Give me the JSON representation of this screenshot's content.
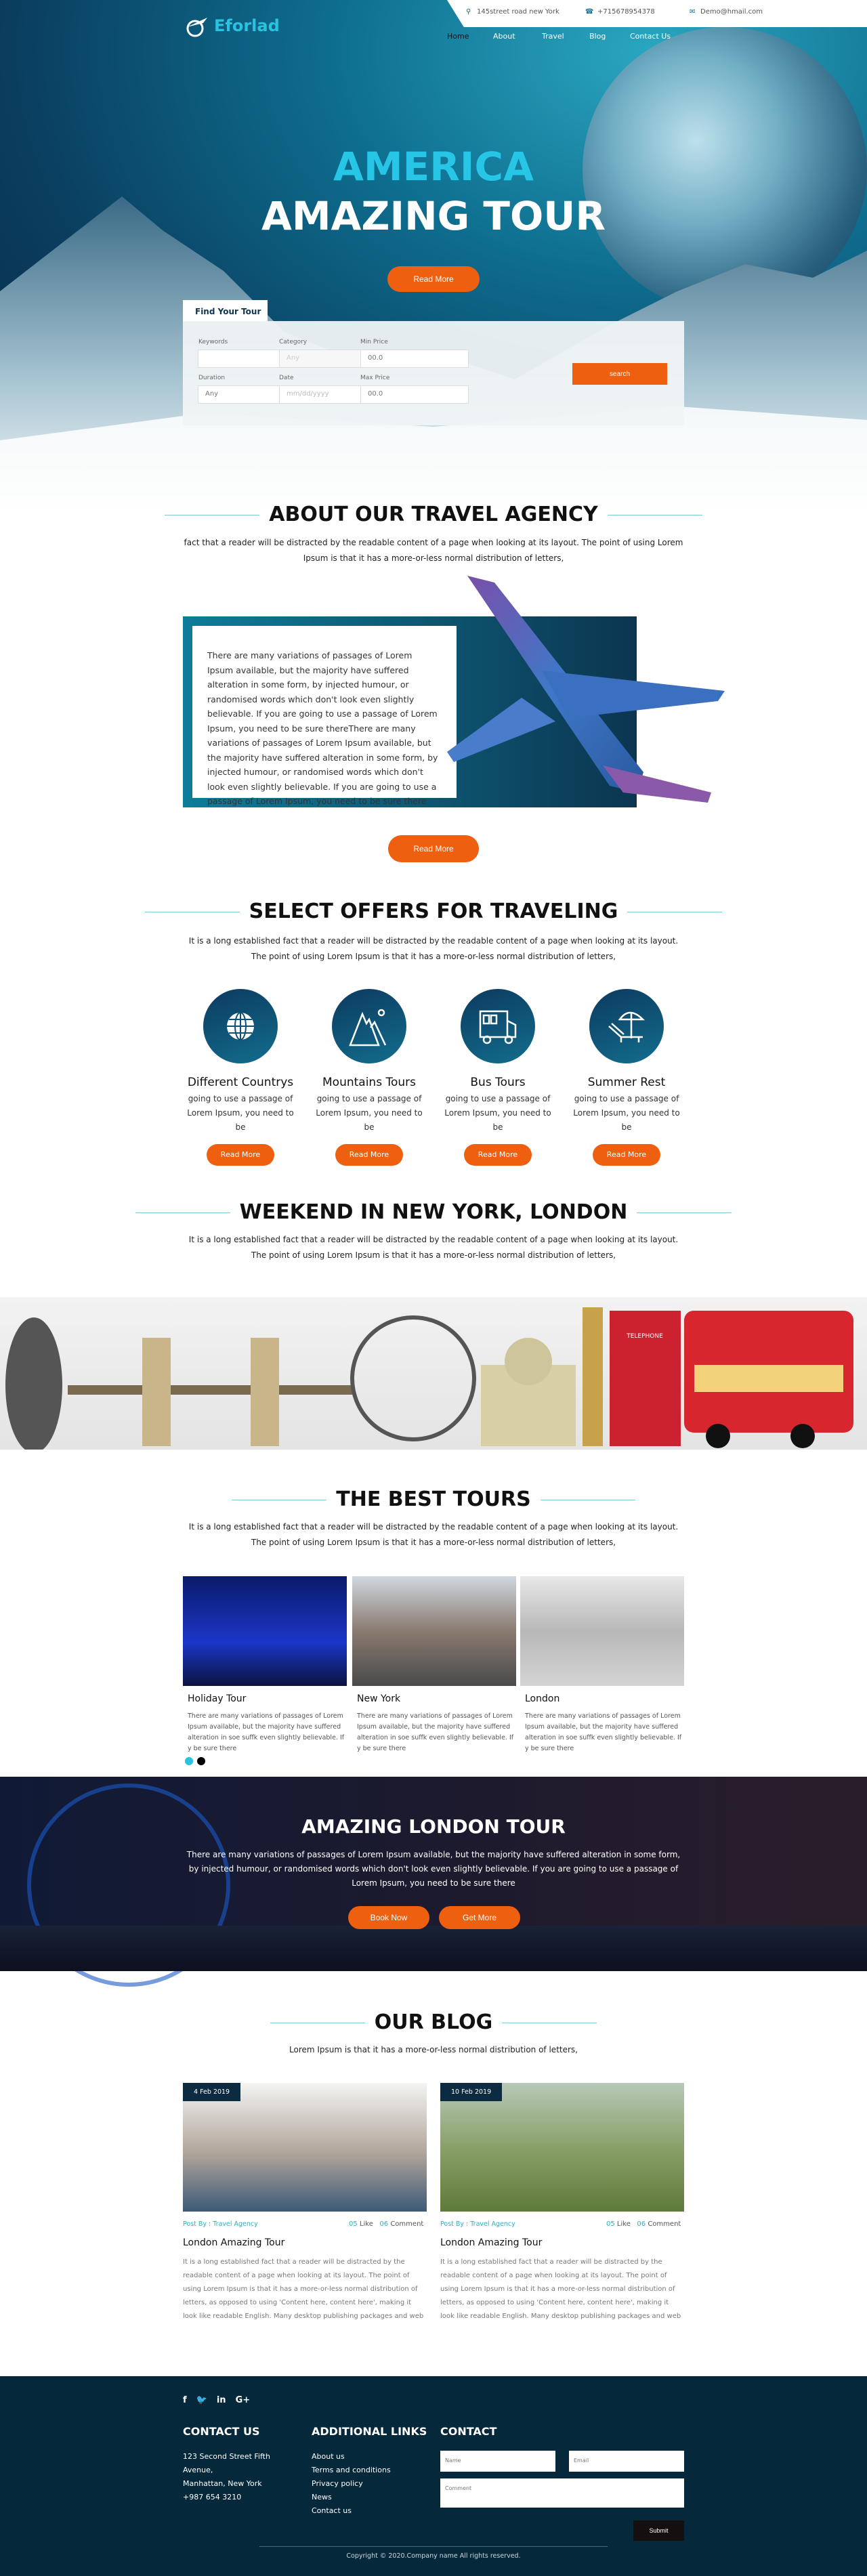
{
  "header": {
    "brand": "Eforlad",
    "address": "145street road new York",
    "phone": "+715678954378",
    "email": "Demo@hmail.com",
    "nav": [
      {
        "label": "Home",
        "active": true
      },
      {
        "label": "About"
      },
      {
        "label": "Travel"
      },
      {
        "label": "Blog"
      },
      {
        "label": "Contact Us"
      }
    ]
  },
  "hero": {
    "title_line1": "AMERICA",
    "title_line2": "AMAZING TOUR",
    "button": "Read More"
  },
  "search": {
    "tab": "Find Your Tour",
    "keywords_label": "Keywords",
    "keywords_value": "",
    "category_label": "Category",
    "category_value": "Any",
    "min_price_label": "Min Price",
    "min_price_value": "00.0",
    "duration_label": "Duration",
    "duration_value": "Any",
    "date_label": "Date",
    "date_placeholder": "mm/dd/yyyy",
    "max_price_label": "Max Price",
    "max_price_value": "00.0",
    "button": "search"
  },
  "about": {
    "title": "ABOUT OUR TRAVEL AGENCY",
    "intro": "fact that a reader will be distracted by the readable content of a page when looking at its layout. The point of using Lorem Ipsum is that it has a more-or-less normal distribution of letters,",
    "body": "There are many variations of passages of Lorem Ipsum available, but the majority have suffered alteration in some form, by injected humour, or randomised words which don't look even slightly believable. If you are going to use a passage of Lorem Ipsum, you need to be sure thereThere are many variations of passages of Lorem Ipsum available, but the majority have suffered alteration in some form, by injected humour, or randomised words which don't look even slightly believable. If you are going to use a passage of Lorem Ipsum, you need to be sure there",
    "button": "Read More"
  },
  "offers": {
    "title": "SELECT OFFERS FOR TRAVELING",
    "intro": "It is a long established fact that a reader will be distracted by the readable content of a page when looking at its layout. The point of using Lorem Ipsum is that it has a more-or-less normal distribution of letters,",
    "items": [
      {
        "title": "Different Countrys",
        "text": "going to use a passage of Lorem Ipsum, you need to be",
        "button": "Read More",
        "icon": "globe-icon"
      },
      {
        "title": "Mountains Tours",
        "text": "going to use a passage of Lorem Ipsum, you need to be",
        "button": "Read More",
        "icon": "mountain-icon"
      },
      {
        "title": "Bus Tours",
        "text": "going to use a passage of Lorem Ipsum, you need to be",
        "button": "Read More",
        "icon": "bus-icon"
      },
      {
        "title": "Summer Rest",
        "text": "going to use a passage of Lorem Ipsum, you need to be",
        "button": "Read More",
        "icon": "beach-umbrella-icon"
      }
    ]
  },
  "weekend": {
    "title": "WEEKEND IN NEW YORK, LONDON",
    "intro": "It is a long established fact that a reader will be distracted by the readable content of a page when looking at its layout. The point of using Lorem Ipsum is that it has a more-or-less normal distribution of letters,",
    "phone_box_label": "TELEPHONE"
  },
  "tours": {
    "title": "THE BEST TOURS",
    "intro": "It is a long established fact that a reader will be distracted by the readable content of a page when looking at its layout. The point of using Lorem Ipsum is that it has a more-or-less normal distribution of letters,",
    "items": [
      {
        "title": "Holiday Tour",
        "text": "There are many variations of passages of Lorem Ipsum available, but the majority have suffered alteration in soe suffk even slightly believable. If y be sure there"
      },
      {
        "title": "New York",
        "text": "There are many variations of passages of Lorem Ipsum available, but the majority have suffered alteration in soe suffk even slightly believable. If y be sure there"
      },
      {
        "title": "London",
        "text": "There are many variations of passages of Lorem Ipsum available, but the majority have suffered alteration in soe suffk even slightly believable. If y be sure there"
      }
    ],
    "active_dot": 0
  },
  "london": {
    "title": "AMAZING LONDON TOUR",
    "text": "There are many variations of passages of Lorem Ipsum available, but the majority have suffered alteration in some form, by injected humour, or randomised words which don't look even slightly believable. If you are going to use a passage of Lorem Ipsum, you need to be sure there",
    "book": "Book Now",
    "more": "Get More"
  },
  "blog": {
    "title": "OUR BLOG",
    "intro": "Lorem Ipsum is that it has a more-or-less normal distribution of letters,",
    "posts": [
      {
        "date": "4 Feb 2019",
        "by": "Post By : Travel Agency",
        "likes": "05",
        "like_label": "Like",
        "comments": "06",
        "comment_label": "Comment",
        "title": "London Amazing Tour",
        "text": "It is a long established fact that a reader will be distracted by the readable content of a page when looking at its layout. The point of using Lorem Ipsum is that it has a more-or-less normal distribution of letters, as opposed to using 'Content here, content here', making it look like readable English. Many desktop publishing packages and web"
      },
      {
        "date": "10 Feb 2019",
        "by": "Post By : Travel Agency",
        "likes": "05",
        "like_label": "Like",
        "comments": "06",
        "comment_label": "Comment",
        "title": "London Amazing Tour",
        "text": "It is a long established fact that a reader will be distracted by the readable content of a page when looking at its layout. The point of using Lorem Ipsum is that it has a more-or-less normal distribution of letters, as opposed to using 'Content here, content here', making it look like readable English. Many desktop publishing packages and web"
      }
    ]
  },
  "footer": {
    "social": [
      "f",
      "🐦",
      "in",
      "G+"
    ],
    "contact_title": "CONTACT US",
    "address_lines": [
      "123 Second Street Fifth",
      "Avenue,",
      "Manhattan, New York",
      "+987 654 3210"
    ],
    "links_title": "ADDITIONAL LINKS",
    "links": [
      "About us",
      "Terms and conditions",
      "Privacy policy",
      "News",
      "Contact us"
    ],
    "form_title": "CONTACT",
    "name_placeholder": "Name",
    "email_placeholder": "Email",
    "comment_placeholder": "Comment",
    "submit": "Submit",
    "copyright": "Copyright © 2020.Company name All rights reserved."
  },
  "colors": {
    "accent": "#ee5f10",
    "brand": "#2ac3df",
    "dark": "#05283b"
  }
}
